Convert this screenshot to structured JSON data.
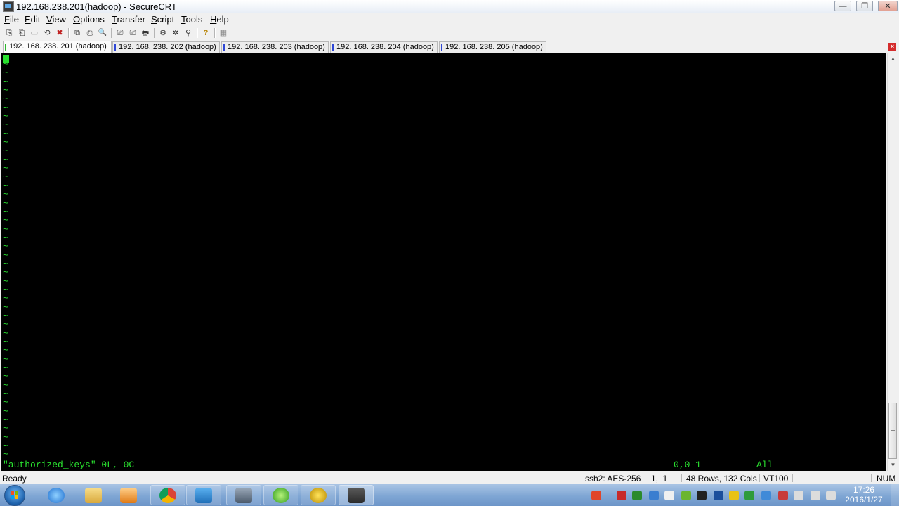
{
  "window": {
    "title": "192.168.238.201(hadoop) - SecureCRT",
    "buttons": {
      "minimize": "—",
      "restore": "❐",
      "close": "✕"
    }
  },
  "menu": {
    "items": [
      {
        "first": "F",
        "rest": "ile"
      },
      {
        "first": "E",
        "rest": "dit"
      },
      {
        "first": "V",
        "rest": "iew"
      },
      {
        "first": "O",
        "rest": "ptions"
      },
      {
        "first": "T",
        "rest": "ransfer"
      },
      {
        "first": "S",
        "rest": "cript"
      },
      {
        "first": "T",
        "rest": "ools"
      },
      {
        "first": "H",
        "rest": "elp"
      }
    ]
  },
  "toolbar": {
    "icons": [
      "connect-icon",
      "quick-connect-icon",
      "connect-in-tab-icon",
      "reconnect-icon",
      "disconnect-icon",
      "copy-icon",
      "paste-icon",
      "find-icon",
      "print-icon",
      "print-selection-icon",
      "print-setup-icon",
      "session-options-icon",
      "global-options-icon",
      "keymap-icon",
      "help-icon",
      "sftp-icon"
    ],
    "glyphs": [
      "⎘",
      "⎗",
      "▭",
      "⟲",
      "✖",
      "⧉",
      "⎙",
      "🔍",
      "⎚",
      "⎚",
      "🖶",
      "⚙",
      "✲",
      "⚲",
      "?",
      "▦"
    ]
  },
  "tabs": [
    {
      "label": "192. 168. 238. 201 (hadoop)"
    },
    {
      "label": "192. 168. 238. 202 (hadoop)"
    },
    {
      "label": "192. 168. 238. 203 (hadoop)"
    },
    {
      "label": "192. 168. 238. 204 (hadoop)"
    },
    {
      "label": "192. 168. 238. 205 (hadoop)"
    }
  ],
  "tab_close_glyph": "×",
  "terminal": {
    "tilde": "~",
    "file_status": "\"authorized_keys\" 0L, 0C",
    "position": "0,0-1",
    "scope": "All"
  },
  "scrollbar": {
    "up": "▲",
    "down": "▼"
  },
  "statusbar": {
    "state": "Ready",
    "cipher": "ssh2: AES-256",
    "cursor": "1,  1",
    "size": "48 Rows, 132 Cols",
    "emulation": "VT100",
    "numlock": "NUM"
  },
  "taskbar": {
    "clock_time": "17:26",
    "clock_date": "2016/1/27",
    "colors": {
      "green": "#29e02f",
      "tab_blue": "#2f47d6"
    }
  }
}
